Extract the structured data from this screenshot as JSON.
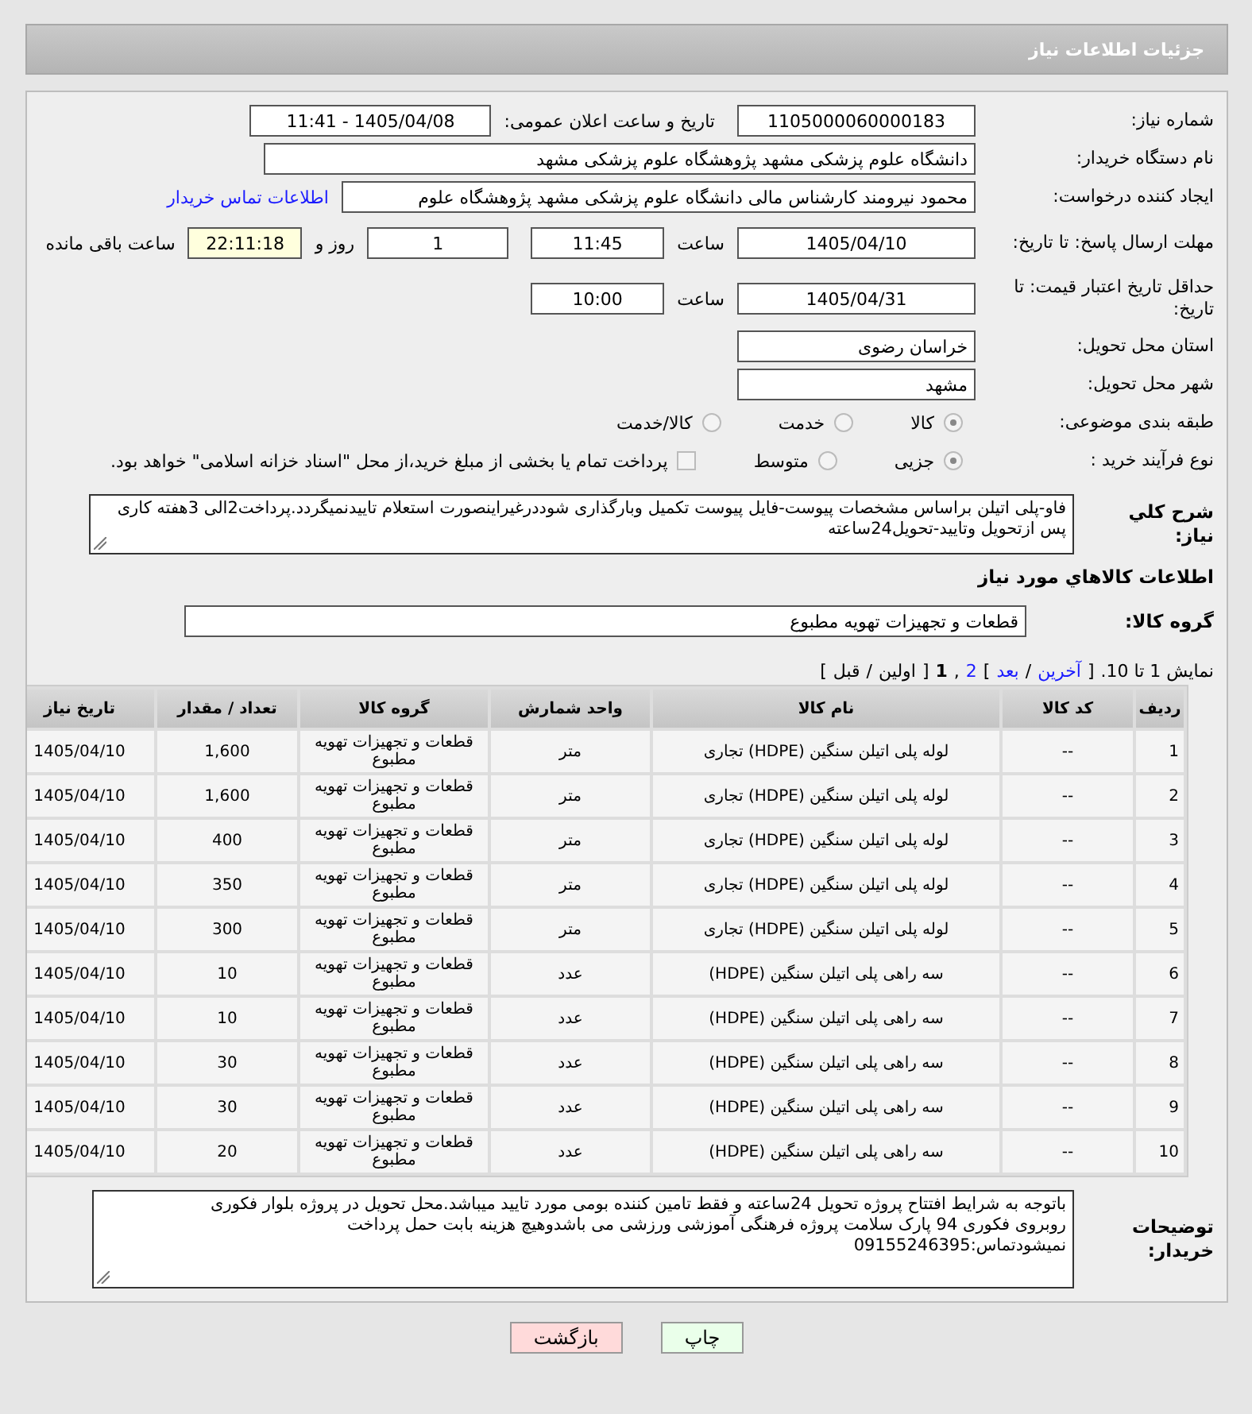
{
  "header": {
    "title": "جزئیات اطلاعات نیاز"
  },
  "fields": {
    "need_number": {
      "label": "شماره نیاز:",
      "value": "1105000060000183"
    },
    "announce": {
      "label": "تاریخ و ساعت اعلان عمومی:",
      "value": "1405/04/08 - 11:41"
    },
    "buyer": {
      "label": "نام دستگاه خریدار:",
      "value": "دانشگاه علوم پزشکی مشهد   پژوهشگاه علوم پزشکی مشهد"
    },
    "creator": {
      "label": "ایجاد کننده درخواست:",
      "value": "محمود نیرومند کارشناس مالی دانشگاه علوم پزشکی مشهد   پژوهشگاه علوم",
      "link": "اطلاعات تماس خریدار"
    },
    "deadline": {
      "label": "مهلت ارسال پاسخ: تا تاریخ:",
      "date": "1405/04/10",
      "time_label": "ساعت",
      "time": "11:45",
      "days": "1",
      "days_label": "روز و",
      "remaining": "22:11:18",
      "remaining_label": "ساعت باقی مانده"
    },
    "validity": {
      "label": "حداقل تاریخ اعتبار قیمت: تا تاریخ:",
      "date": "1405/04/31",
      "time_label": "ساعت",
      "time": "10:00"
    },
    "province": {
      "label": "استان محل تحویل:",
      "value": "خراسان رضوی"
    },
    "city": {
      "label": "شهر محل تحویل:",
      "value": "مشهد"
    },
    "category": {
      "label": "طبقه بندی موضوعی:",
      "options": [
        {
          "label": "کالا",
          "selected": true
        },
        {
          "label": "خدمت",
          "selected": false
        },
        {
          "label": "کالا/خدمت",
          "selected": false
        }
      ]
    },
    "process": {
      "label": "نوع فرآیند خرید :",
      "options": [
        {
          "label": "جزیی",
          "selected": true
        },
        {
          "label": "متوسط",
          "selected": false
        }
      ],
      "treasury": {
        "label": "پرداخت تمام یا بخشی از مبلغ خرید،از محل \"اسناد خزانه اسلامی\" خواهد بود.",
        "checked": false
      }
    }
  },
  "description": {
    "label": "شرح کلي نياز:",
    "text": "فاو-پلی اتیلن براساس مشخصات پیوست-فایل پیوست تکمیل وبارگذاری شوددرغیراینصورت استعلام تاییدنمیگردد.پرداخت2الی 3هفته کاری پس ازتحویل وتایید-تحویل24ساعته"
  },
  "goods_title": "اطلاعات کالاهاي مورد نياز",
  "goods_group": {
    "label": "گروه کالا:",
    "value": "قطعات و تجهیزات تهویه مطبوع"
  },
  "pagination": [
    {
      "kind": "text",
      "text": "نمایش 1 تا 10."
    },
    {
      "kind": "text",
      "text": "]"
    },
    {
      "kind": "link",
      "text": "آخرین"
    },
    {
      "kind": "text",
      "text": "/"
    },
    {
      "kind": "link",
      "text": "بعد"
    },
    {
      "kind": "text",
      "text": "["
    },
    {
      "kind": "link",
      "text": "2"
    },
    {
      "kind": "text",
      "text": ","
    },
    {
      "kind": "current",
      "text": "1"
    },
    {
      "kind": "text",
      "text": "]"
    },
    {
      "kind": "text",
      "text": "اولین"
    },
    {
      "kind": "text",
      "text": "/"
    },
    {
      "kind": "text",
      "text": "قبل"
    },
    {
      "kind": "text",
      "text": "["
    }
  ],
  "table": {
    "columns": [
      "ردیف",
      "کد کالا",
      "نام کالا",
      "واحد شمارش",
      "گروه کالا",
      "تعداد / مقدار",
      "تاریخ نیاز"
    ],
    "rows": [
      [
        "1",
        "--",
        "لوله پلی اتیلن سنگین (HDPE) تجاری",
        "متر",
        "قطعات و تجهیزات تهویه مطبوع",
        "1,600",
        "1405/04/10"
      ],
      [
        "2",
        "--",
        "لوله پلی اتیلن سنگین (HDPE) تجاری",
        "متر",
        "قطعات و تجهیزات تهویه مطبوع",
        "1,600",
        "1405/04/10"
      ],
      [
        "3",
        "--",
        "لوله پلی اتیلن سنگین (HDPE) تجاری",
        "متر",
        "قطعات و تجهیزات تهویه مطبوع",
        "400",
        "1405/04/10"
      ],
      [
        "4",
        "--",
        "لوله پلی اتیلن سنگین (HDPE) تجاری",
        "متر",
        "قطعات و تجهیزات تهویه مطبوع",
        "350",
        "1405/04/10"
      ],
      [
        "5",
        "--",
        "لوله پلی اتیلن سنگین (HDPE) تجاری",
        "متر",
        "قطعات و تجهیزات تهویه مطبوع",
        "300",
        "1405/04/10"
      ],
      [
        "6",
        "--",
        "سه راهی پلی اتیلن سنگین (HDPE)",
        "عدد",
        "قطعات و تجهیزات تهویه مطبوع",
        "10",
        "1405/04/10"
      ],
      [
        "7",
        "--",
        "سه راهی پلی اتیلن سنگین (HDPE)",
        "عدد",
        "قطعات و تجهیزات تهویه مطبوع",
        "10",
        "1405/04/10"
      ],
      [
        "8",
        "--",
        "سه راهی پلی اتیلن سنگین (HDPE)",
        "عدد",
        "قطعات و تجهیزات تهویه مطبوع",
        "30",
        "1405/04/10"
      ],
      [
        "9",
        "--",
        "سه راهی پلی اتیلن سنگین (HDPE)",
        "عدد",
        "قطعات و تجهیزات تهویه مطبوع",
        "30",
        "1405/04/10"
      ],
      [
        "10",
        "--",
        "سه راهی پلی اتیلن سنگین (HDPE)",
        "عدد",
        "قطعات و تجهیزات تهویه مطبوع",
        "20",
        "1405/04/10"
      ]
    ]
  },
  "buyer_notes": {
    "label": "توضیحات خریدار:",
    "lines": [
      "باتوجه به شرایط افتتاح پروژه تحویل 24ساعته و فقط تامین کننده بومی مورد تایید میباشد.محل تحویل در پروژه بلوار فکوری",
      "روبروی فکوری 94 پارک سلامت پروژه فرهنگی آموزشی ورزشی می باشدوهیچ هزینه بابت حمل  پرداخت",
      "نمیشودتماس:09155246395"
    ]
  },
  "buttons": [
    {
      "label": "چاپ",
      "kind": "print"
    },
    {
      "label": "بازگشت",
      "kind": "back"
    }
  ]
}
